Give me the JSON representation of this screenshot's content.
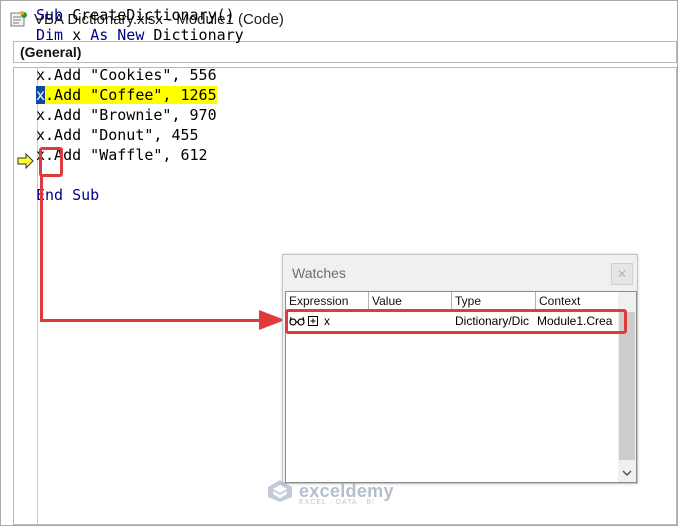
{
  "window": {
    "title": "VBA Dictionary.xlsx - Module1 (Code)"
  },
  "toolbar": {
    "object_combo": "(General)"
  },
  "code": {
    "lines": [
      "Sub CreateDictionary()",
      "Dim x As New Dictionary",
      "",
      "x.Add \"Cookies\", 556",
      "x.Add \"Coffee\", 1265",
      "x.Add \"Brownie\", 970",
      "x.Add \"Donut\", 455",
      "x.Add \"Waffle\", 612",
      "",
      "End Sub"
    ]
  },
  "watches": {
    "title": "Watches",
    "columns": [
      "Expression",
      "Value",
      "Type",
      "Context"
    ],
    "rows": [
      {
        "expression": "x",
        "value": "",
        "type": "Dictionary/Dic",
        "context": "Module1.Crea"
      }
    ]
  },
  "watermark": {
    "name": "exceldemy",
    "tagline": "EXCEL · DATA · BI"
  },
  "colors": {
    "highlight": "#ffff00",
    "selection": "#0a4aa4",
    "callout": "#e03b3b",
    "keyword": "#00008b"
  }
}
